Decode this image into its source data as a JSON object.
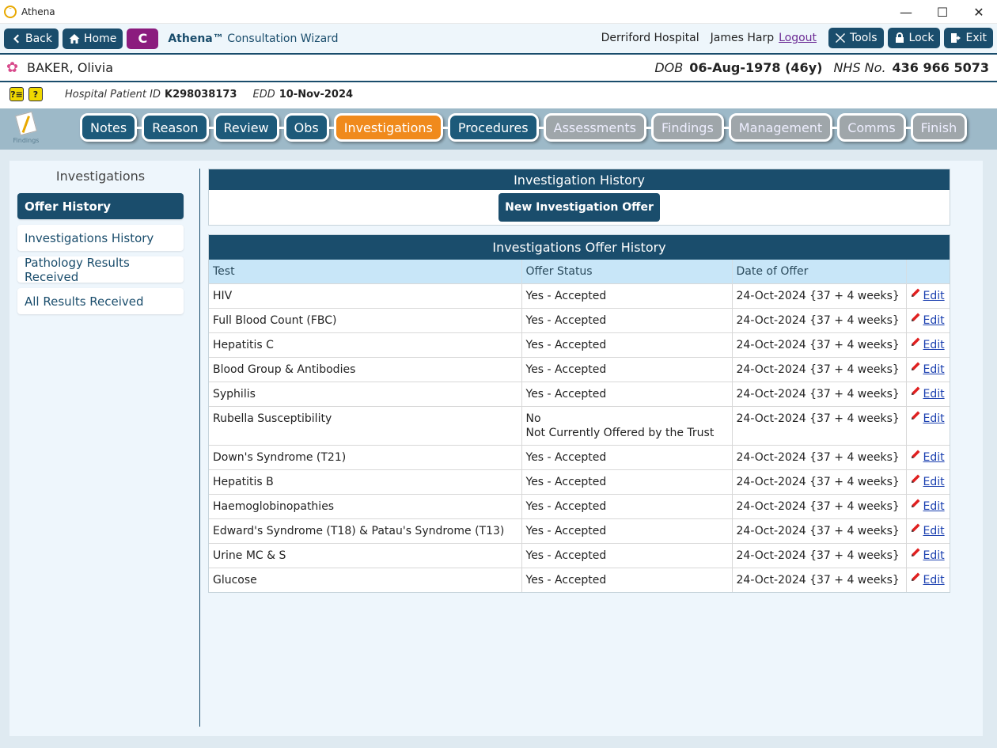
{
  "window": {
    "title": "Athena",
    "controls": [
      "—",
      "☐",
      "✕"
    ]
  },
  "toolbar": {
    "back_label": "Back",
    "home_label": "Home",
    "c_label": "C",
    "wizard_brand": "Athena™",
    "wizard_title": " Consultation Wizard",
    "hospital": "Derriford Hospital",
    "user": "James Harp",
    "logout_label": "Logout",
    "tools_label": "Tools",
    "lock_label": "Lock",
    "exit_label": "Exit"
  },
  "patient": {
    "name": "BAKER, Olivia",
    "dob_label": "DOB",
    "dob_value": "06-Aug-1978 (46y)",
    "nhs_label": "NHS No.",
    "nhs_value": "436 966 5073",
    "hospital_id_label": "Hospital Patient ID",
    "hospital_id_value": "K298038173",
    "edd_label": "EDD",
    "edd_value": "10-Nov-2024",
    "icon1_text": "?≡",
    "icon2_text": "?"
  },
  "stepnav": {
    "findings_icon_label": "Findings",
    "steps": [
      {
        "label": "Notes",
        "state": "active"
      },
      {
        "label": "Reason",
        "state": "active"
      },
      {
        "label": "Review",
        "state": "active"
      },
      {
        "label": "Obs",
        "state": "active"
      },
      {
        "label": "Investigations",
        "state": "current"
      },
      {
        "label": "Procedures",
        "state": "active"
      },
      {
        "label": "Assessments",
        "state": "future"
      },
      {
        "label": "Findings",
        "state": "future"
      },
      {
        "label": "Management",
        "state": "future"
      },
      {
        "label": "Comms",
        "state": "future"
      },
      {
        "label": "Finish",
        "state": "future"
      }
    ]
  },
  "sidebar": {
    "title": "Investigations",
    "items": [
      {
        "label": "Offer History",
        "selected": true
      },
      {
        "label": "Investigations History",
        "selected": false
      },
      {
        "label": "Pathology Results Received",
        "selected": false
      },
      {
        "label": "All Results Received",
        "selected": false
      }
    ]
  },
  "history_box": {
    "title": "Investigation History",
    "new_offer_label": "New Investigation Offer"
  },
  "offer_table": {
    "title": "Investigations Offer History",
    "columns": [
      "Test",
      "Offer Status",
      "Date of Offer",
      ""
    ],
    "edit_label": "Edit",
    "rows": [
      {
        "test": "HIV",
        "status": [
          "Yes - Accepted"
        ],
        "date": "24-Oct-2024 {37 + 4 weeks}"
      },
      {
        "test": "Full Blood Count (FBC)",
        "status": [
          "Yes - Accepted"
        ],
        "date": "24-Oct-2024 {37 + 4 weeks}"
      },
      {
        "test": "Hepatitis C",
        "status": [
          "Yes - Accepted"
        ],
        "date": "24-Oct-2024 {37 + 4 weeks}"
      },
      {
        "test": "Blood Group & Antibodies",
        "status": [
          "Yes - Accepted"
        ],
        "date": "24-Oct-2024 {37 + 4 weeks}"
      },
      {
        "test": "Syphilis",
        "status": [
          "Yes - Accepted"
        ],
        "date": "24-Oct-2024 {37 + 4 weeks}"
      },
      {
        "test": "Rubella Susceptibility",
        "status": [
          "No",
          "Not Currently Offered by the Trust"
        ],
        "date": "24-Oct-2024 {37 + 4 weeks}"
      },
      {
        "test": "Down's Syndrome (T21)",
        "status": [
          "Yes - Accepted"
        ],
        "date": "24-Oct-2024 {37 + 4 weeks}"
      },
      {
        "test": "Hepatitis B",
        "status": [
          "Yes - Accepted"
        ],
        "date": "24-Oct-2024 {37 + 4 weeks}"
      },
      {
        "test": "Haemoglobinopathies",
        "status": [
          "Yes - Accepted"
        ],
        "date": "24-Oct-2024 {37 + 4 weeks}"
      },
      {
        "test": "Edward's Syndrome (T18) & Patau's Syndrome (T13)",
        "status": [
          "Yes - Accepted"
        ],
        "date": "24-Oct-2024 {37 + 4 weeks}"
      },
      {
        "test": "Urine MC & S",
        "status": [
          "Yes - Accepted"
        ],
        "date": "24-Oct-2024 {37 + 4 weeks}"
      },
      {
        "test": "Glucose",
        "status": [
          "Yes - Accepted"
        ],
        "date": "24-Oct-2024 {37 + 4 weeks}"
      }
    ]
  },
  "colors": {
    "primary": "#1a4d6c",
    "current_step": "#f08a1c",
    "future_step": "#9fa6aa",
    "c_button": "#8b1c7e",
    "table_header": "#c8e6f8"
  }
}
